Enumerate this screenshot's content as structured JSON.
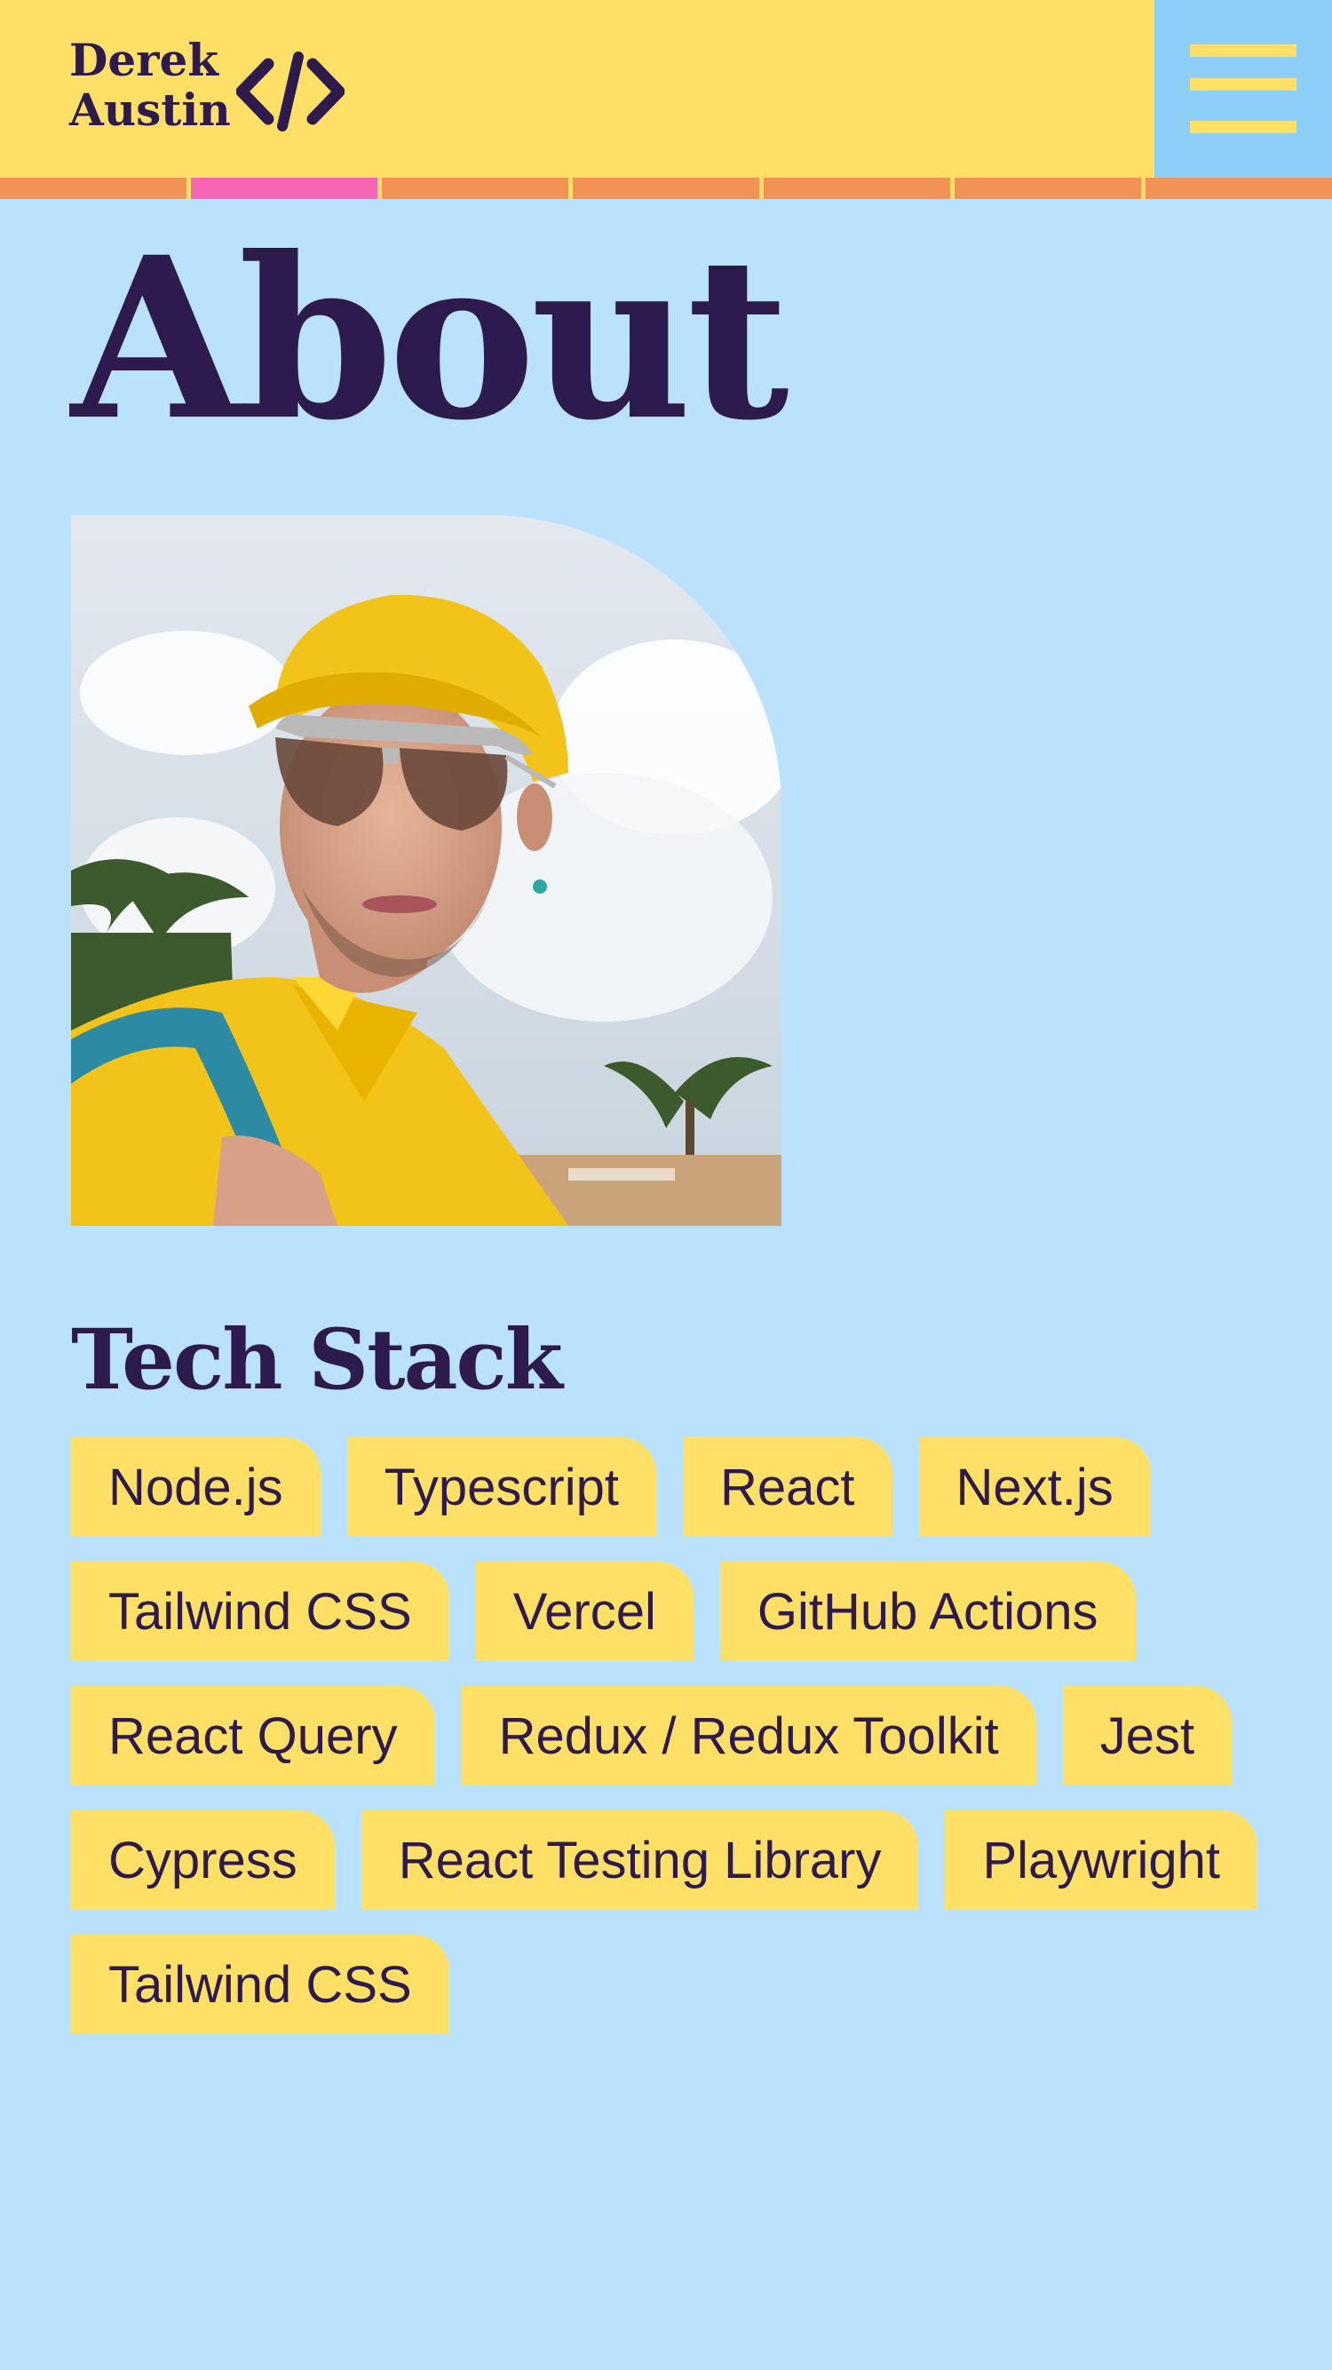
{
  "header": {
    "logo_line1": "Derek",
    "logo_line2": "Austin",
    "logo_icon": "code-brackets-icon",
    "menu_icon": "hamburger-menu-icon",
    "tab_colors": [
      "#f39257",
      "#f766b5",
      "#f39257",
      "#f39257",
      "#f39257",
      "#f39257",
      "#f39257"
    ],
    "active_tab_index": 1
  },
  "main": {
    "title": "About",
    "photo": "portrait-photo",
    "tech_stack": {
      "heading": "Tech Stack",
      "tags": [
        "Node.js",
        "Typescript",
        "React",
        "Next.js",
        "Tailwind CSS",
        "Vercel",
        "GitHub Actions",
        "React Query",
        "Redux / Redux Toolkit",
        "Jest",
        "Cypress",
        "React Testing Library",
        "Playwright",
        "Tailwind CSS"
      ]
    }
  },
  "colors": {
    "header_bg": "#ffe066",
    "page_bg": "#bae2fd",
    "menu_bg": "#8ecff9",
    "text": "#2d1b4e",
    "tab_orange": "#f39257",
    "tab_pink": "#f766b5",
    "tag_bg": "#ffe066"
  }
}
